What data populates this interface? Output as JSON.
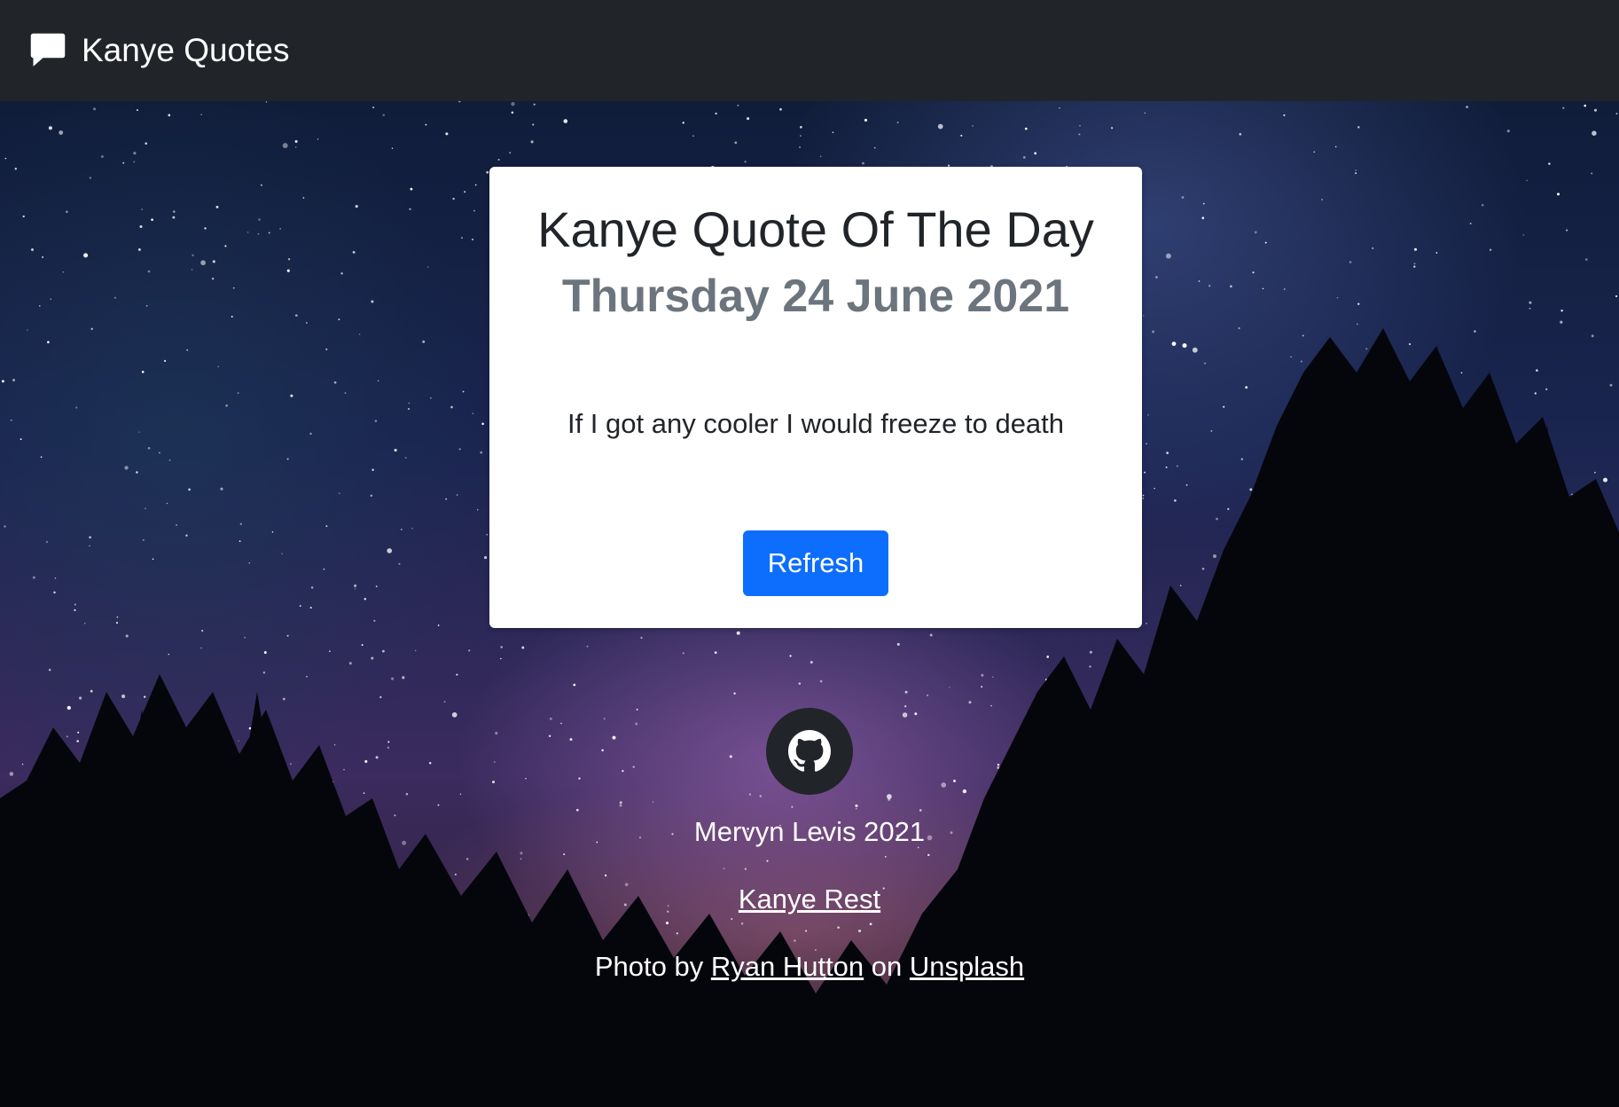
{
  "navbar": {
    "brand_icon": "chat-bubble-icon",
    "title": "Kanye Quotes"
  },
  "card": {
    "title": "Kanye Quote Of The Day",
    "date": "Thursday 24 June 2021",
    "quote": "If I got any cooler I would freeze to death",
    "refresh_label": "Refresh",
    "button_color": "#0d6efd"
  },
  "footer": {
    "github_icon": "github-icon",
    "author": "Mervyn Levis 2021",
    "api_link": "Kanye Rest",
    "credit_prefix": "Photo by",
    "photographer_link": "Ryan Hutton",
    "credit_mid": "on",
    "source_link": "Unsplash"
  },
  "colors": {
    "navbar_bg": "#212529",
    "card_bg": "#ffffff",
    "date_text": "#6c757d"
  }
}
